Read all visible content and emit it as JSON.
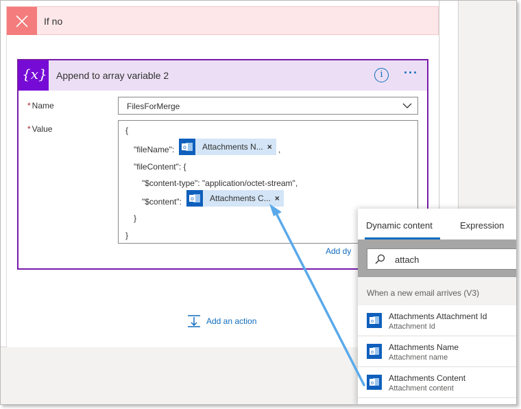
{
  "condition": {
    "title": "If no"
  },
  "action": {
    "title": "Append to array variable 2",
    "icon_text": "{x}",
    "info_icon": "info-icon",
    "more_label": "···",
    "name_label": "Name",
    "name_value": "FilesForMerge",
    "value_label": "Value",
    "required_mark": "*",
    "value_lines": {
      "open_brace": "{",
      "filename_key": "\"fileName\":",
      "filename_comma": ",",
      "filecontent_key": "\"fileContent\": {",
      "contenttype_line": "\"$content-type\": \"application/octet-stream\",",
      "content_key": "\"$content\":",
      "inner_close": "}",
      "outer_close": "}"
    },
    "tokens": [
      {
        "label": "Attachments N...",
        "remove": "×"
      },
      {
        "label": "Attachments C...",
        "remove": "×"
      }
    ],
    "add_dynamic_label": "Add dy"
  },
  "add_action": {
    "label": "Add an action"
  },
  "dynamic_panel": {
    "tabs": [
      "Dynamic content",
      "Expression"
    ],
    "active_tab": 0,
    "search_value": "attach",
    "section_title": "When a new email arrives (V3)",
    "items": [
      {
        "title": "Attachments Attachment Id",
        "subtitle": "Attachment Id"
      },
      {
        "title": "Attachments Name",
        "subtitle": "Attachment name"
      },
      {
        "title": "Attachments Content",
        "subtitle": "Attachment content"
      }
    ]
  },
  "colors": {
    "accent": "#0f6cbd",
    "variable_purple": "#770bd6",
    "outlook_blue": "#0f5fbc",
    "token_bg": "#d3e5f6",
    "if_no_red": "#f47c7c",
    "arrow": "#5aa9ea"
  }
}
